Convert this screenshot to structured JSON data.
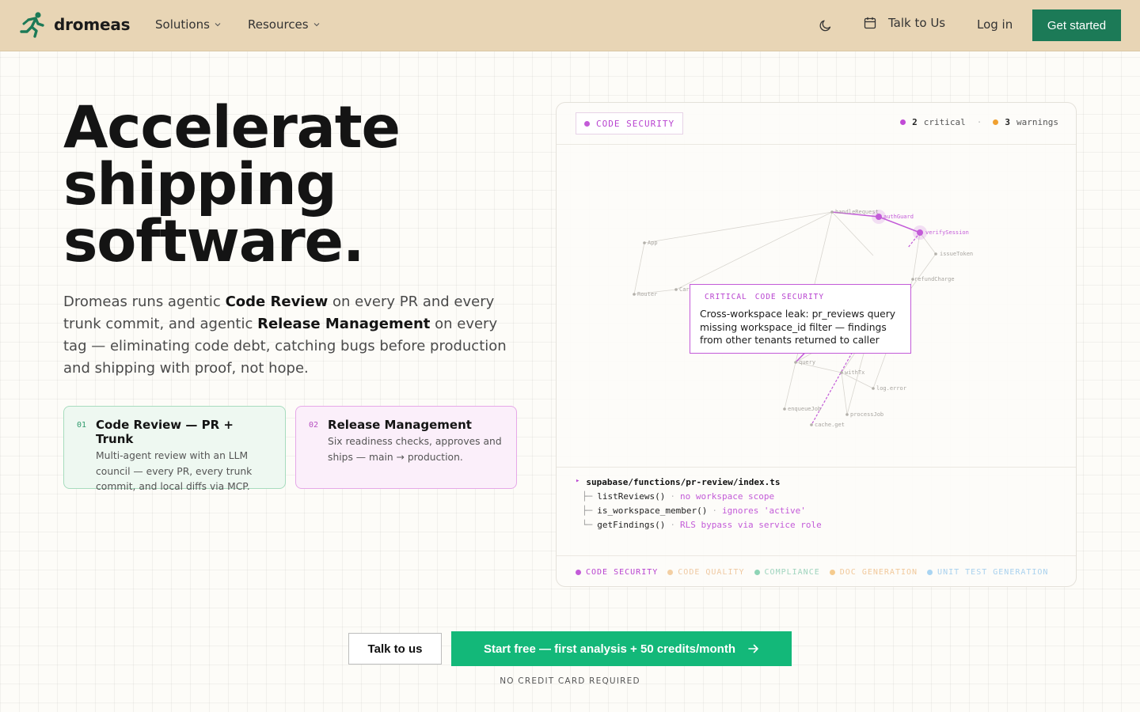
{
  "header": {
    "brand": "dromeas",
    "nav": [
      {
        "label": "Solutions"
      },
      {
        "label": "Resources"
      }
    ],
    "talk_label": "Talk to Us",
    "login_label": "Log in",
    "cta_label": "Get started",
    "colors": {
      "bar": "#e8d5b5",
      "cta": "#1c7a57",
      "logo": "#1c7a57"
    }
  },
  "hero": {
    "title_lines": [
      "Accelerate",
      "shipping",
      "software."
    ],
    "sub": {
      "p1": "Dromeas runs agentic ",
      "b1": "Code Review",
      "p2": " on every PR and every trunk commit, and agentic ",
      "b2": "Release Management",
      "p3": " on every tag — eliminating code debt, catching bugs before production and shipping with proof, not hope."
    }
  },
  "features": [
    {
      "num": "01",
      "title": "Code Review — PR + Trunk",
      "desc": "Multi-agent review with an LLM council — every PR, every trunk commit, and local diffs via MCP."
    },
    {
      "num": "02",
      "title": "Release Management",
      "desc": "Six readiness checks, approves and ships — main → production."
    }
  ],
  "card": {
    "tag": "CODE SECURITY",
    "critical_count": "2",
    "critical_label": "critical",
    "warnings_count": "3",
    "warnings_label": "warnings",
    "graph_nodes": [
      "handleRequest",
      "authGuard",
      "verifySession",
      "App",
      "issueToken",
      "refundCharge",
      "Router",
      "Cart",
      "query",
      "withTx",
      "log.error",
      "enqueueJob",
      "processJob",
      "cache.get"
    ],
    "tooltip": {
      "severity": "CRITICAL",
      "category": "CODE SECURITY",
      "text": "Cross-workspace leak: pr_reviews query missing workspace_id filter — findings from other tenants returned to caller"
    },
    "tree": {
      "path": "supabase/functions/pr-review/index.ts",
      "rows": [
        {
          "branch": "├─",
          "fn": "listReviews()",
          "note": "no workspace scope"
        },
        {
          "branch": "├─",
          "fn": "is_workspace_member()",
          "note": "ignores 'active'"
        },
        {
          "branch": "└─",
          "fn": "getFindings()",
          "note": "RLS bypass via service role"
        }
      ]
    },
    "footer": [
      {
        "label": "CODE SECURITY",
        "color": "#b843d0",
        "dot": "#c35bd8"
      },
      {
        "label": "CODE QUALITY",
        "color": "#efc9a2",
        "dot": "#f3cfa3"
      },
      {
        "label": "COMPLIANCE",
        "color": "#9fd4be",
        "dot": "#8ed4b6"
      },
      {
        "label": "DOC GENERATION",
        "color": "#f1c89a",
        "dot": "#f5cb8e"
      },
      {
        "label": "UNIT TEST GENERATION",
        "color": "#a9d1ee",
        "dot": "#a9d4f2"
      }
    ],
    "colors": {
      "critical": "#c14ad6",
      "warning": "#f0a030"
    }
  },
  "cta": {
    "talk_label": "Talk to us",
    "start_label": "Start free — first analysis + 50 credits/month",
    "note": "NO CREDIT CARD REQUIRED",
    "colors": {
      "start": "#13b879"
    }
  }
}
